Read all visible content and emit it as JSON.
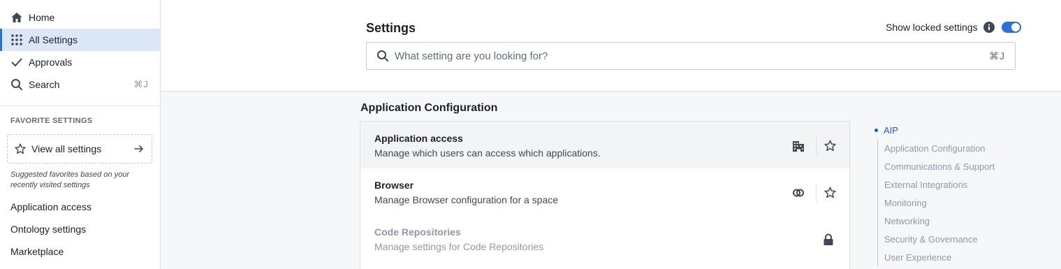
{
  "sidebar": {
    "nav": [
      {
        "label": "Home",
        "icon": "home-icon"
      },
      {
        "label": "All Settings",
        "icon": "grid-icon"
      },
      {
        "label": "Approvals",
        "icon": "checkmark-icon"
      },
      {
        "label": "Search",
        "icon": "search-icon",
        "shortcut": "⌘J"
      }
    ],
    "favorites_heading": "FAVORITE SETTINGS",
    "view_all_label": "View all settings",
    "suggested_note": "Suggested favorites based on your recently visited settings",
    "favorites": [
      "Application access",
      "Ontology settings",
      "Marketplace"
    ]
  },
  "header": {
    "title": "Settings",
    "show_locked_label": "Show locked settings",
    "show_locked_on": true,
    "search_placeholder": "What setting are you looking for?",
    "search_value": "",
    "search_shortcut": "⌘J"
  },
  "main": {
    "section_title": "Application Configuration",
    "settings": [
      {
        "name": "Application access",
        "description": "Manage which users can access which applications.",
        "icon": "building-icon",
        "locked": false
      },
      {
        "name": "Browser",
        "description": "Manage Browser configuration for a space",
        "icon": "link-rings-icon",
        "locked": false
      },
      {
        "name": "Code Repositories",
        "description": "Manage settings for Code Repositories",
        "icon": "lock-icon",
        "locked": true
      }
    ]
  },
  "toc": {
    "active": "AIP",
    "items": [
      "Application Configuration",
      "Communications & Support",
      "External Integrations",
      "Monitoring",
      "Networking",
      "Security & Governance",
      "User Experience"
    ]
  },
  "colors": {
    "accent": "#2d72d2",
    "active_nav_bg": "#dbe6f6",
    "toc_active": "#215db0",
    "muted_text": "#8f99a8"
  }
}
